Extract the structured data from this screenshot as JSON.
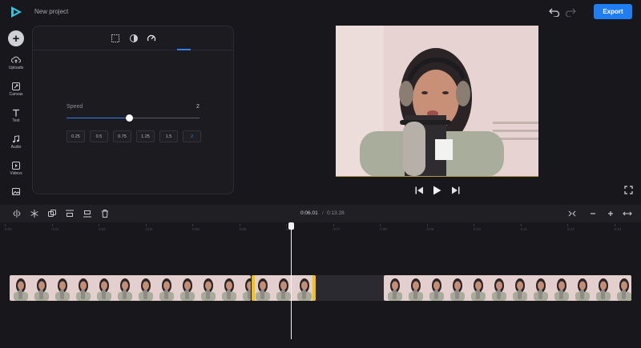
{
  "app": {
    "project_title": "New project",
    "export_label": "Export"
  },
  "colors": {
    "accent": "#1f7ff2",
    "selection": "#f1c21b",
    "background": "#17171c"
  },
  "sidebar": {
    "add_icon": "plus-icon",
    "items": [
      {
        "label": "Uploads",
        "icon": "upload-cloud-icon"
      },
      {
        "label": "Canvas",
        "icon": "canvas-resize-icon"
      },
      {
        "label": "Text",
        "icon": "text-T-icon"
      },
      {
        "label": "Audio",
        "icon": "music-note-icon"
      },
      {
        "label": "Videos",
        "icon": "video-play-icon"
      },
      {
        "label": "",
        "icon": "image-icon"
      }
    ]
  },
  "panel": {
    "tabs": [
      {
        "icon": "crop-icon"
      },
      {
        "icon": "contrast-icon"
      },
      {
        "icon": "speedometer-icon",
        "active": true
      }
    ],
    "speed": {
      "label": "Speed",
      "value": "2",
      "level_fraction": 0.47,
      "presets": [
        "0.25",
        "0.5",
        "0.75",
        "1.25",
        "1.5",
        "2"
      ],
      "active_preset": "2"
    }
  },
  "player": {
    "controls": [
      "skip-back-icon",
      "play-icon",
      "skip-forward-icon"
    ],
    "fullscreen_icon": "fullscreen-icon"
  },
  "timeline": {
    "current_time": "0:06.01",
    "separator": "/",
    "total_time": "0:13.28",
    "tools": [
      "split-icon",
      "freeze-icon",
      "duplicate-icon",
      "align-top-icon",
      "align-bottom-icon",
      "delete-icon"
    ],
    "zoom": [
      "fit-icon",
      "zoom-out-icon",
      "zoom-in-icon",
      "expand-icon"
    ],
    "ruler": [
      "0:00",
      "0:01",
      "0:02",
      "0:03",
      "0:04",
      "0:05",
      "0:06",
      "0:07",
      "0:08",
      "0:09",
      "0:10",
      "0:11",
      "0:12",
      "0:13"
    ]
  }
}
